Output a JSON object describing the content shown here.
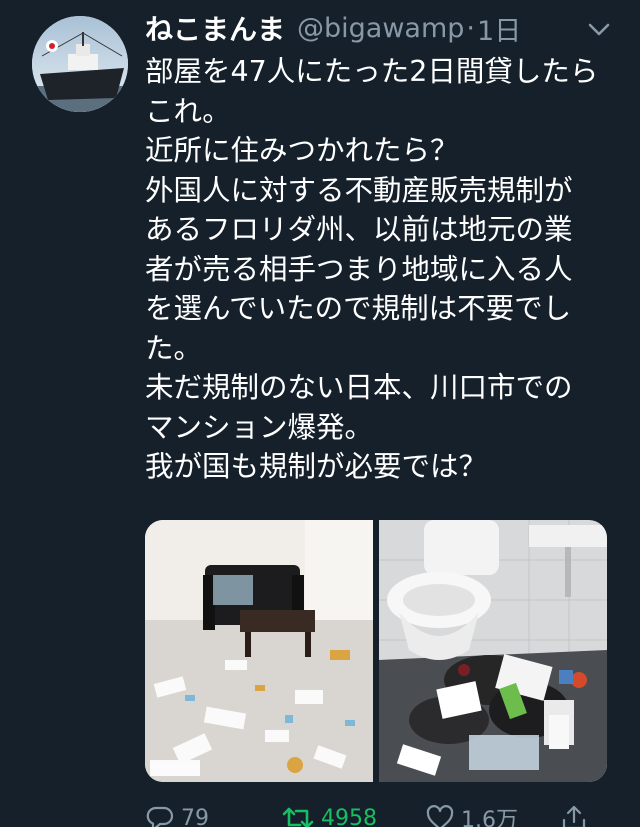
{
  "tweet": {
    "display_name": "ねこまんま",
    "handle": "@bigawamp",
    "separator": "·",
    "time": "1日",
    "text": "部屋を47人にたった2日間貸したらこれ。\n近所に住みつかれたら？\n外国人に対する不動産販売規制があるフロリダ州、以前は地元の業者が売る相手つまり地域に入る人を選んでいたので規制は不要でした。\n未だ規制のない日本、川口市でのマンション爆発。\n我が国も規制が必要では？",
    "media": [
      {
        "icon": "photo-room-trash"
      },
      {
        "icon": "photo-toilet-trash"
      }
    ],
    "actions": {
      "reply_count": "79",
      "retweet_count": "4958",
      "like_count": "1.6万"
    }
  },
  "colors": {
    "background": "#15202b",
    "text": "#ffffff",
    "muted": "#8899a6",
    "retweet_active": "#17bf63"
  },
  "icons": {
    "caret": "chevron-down-icon",
    "reply": "reply-icon",
    "retweet": "retweet-icon",
    "like": "heart-icon",
    "share": "share-icon"
  }
}
